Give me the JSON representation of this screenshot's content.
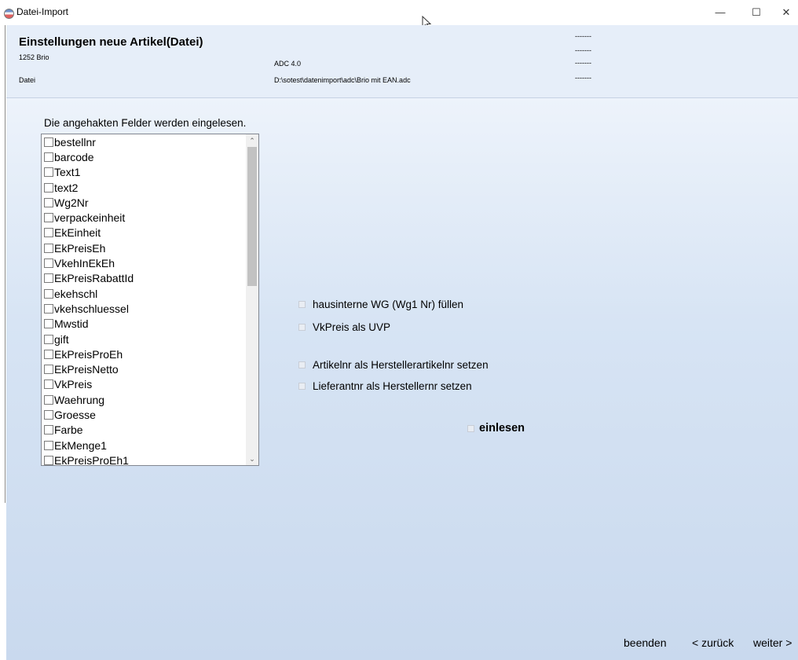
{
  "window": {
    "title": "Datei-Import",
    "minimize": "—",
    "maximize": "☐",
    "close": "✕"
  },
  "header": {
    "title": "Einstellungen neue Artikel(Datei)",
    "subtitle": "1252 Brio",
    "format": "ADC 4.0",
    "file_label": "Datei",
    "file_path": "D:\\sotest\\datenimport\\adc\\Brio mit EAN.adc",
    "dashes": [
      "-------",
      "-------",
      "-------",
      "-------"
    ]
  },
  "main": {
    "instruction": "Die angehakten Felder werden eingelesen.",
    "fields": [
      "bestellnr",
      "barcode",
      "Text1",
      "text2",
      "Wg2Nr",
      "verpackeinheit",
      "EkEinheit",
      "EkPreisEh",
      "VkehInEkEh",
      "EkPreisRabattId",
      "ekehschl",
      "vkehschluessel",
      "Mwstid",
      "gift",
      "EkPreisProEh",
      "EkPreisNetto",
      "VkPreis",
      "Waehrung",
      "Groesse",
      "Farbe",
      "EkMenge1",
      "EkPreisProEh1"
    ],
    "options": {
      "hausinterne_wg": "hausinterne WG (Wg1 Nr) füllen",
      "vkpreis_uvp": "VkPreis als UVP",
      "artikelnr_hersteller": "Artikelnr als Herstellerartikelnr setzen",
      "lieferantnr_hersteller": "Lieferantnr als Herstellernr setzen"
    },
    "einlesen": "einlesen"
  },
  "footer": {
    "beenden": "beenden",
    "zurueck": "< zurück",
    "weiter": "weiter >"
  },
  "colors": {
    "header_bg": "#e6eef9",
    "main_bg_top": "#edf3fb",
    "main_bg_bottom": "#c9d9ee"
  }
}
